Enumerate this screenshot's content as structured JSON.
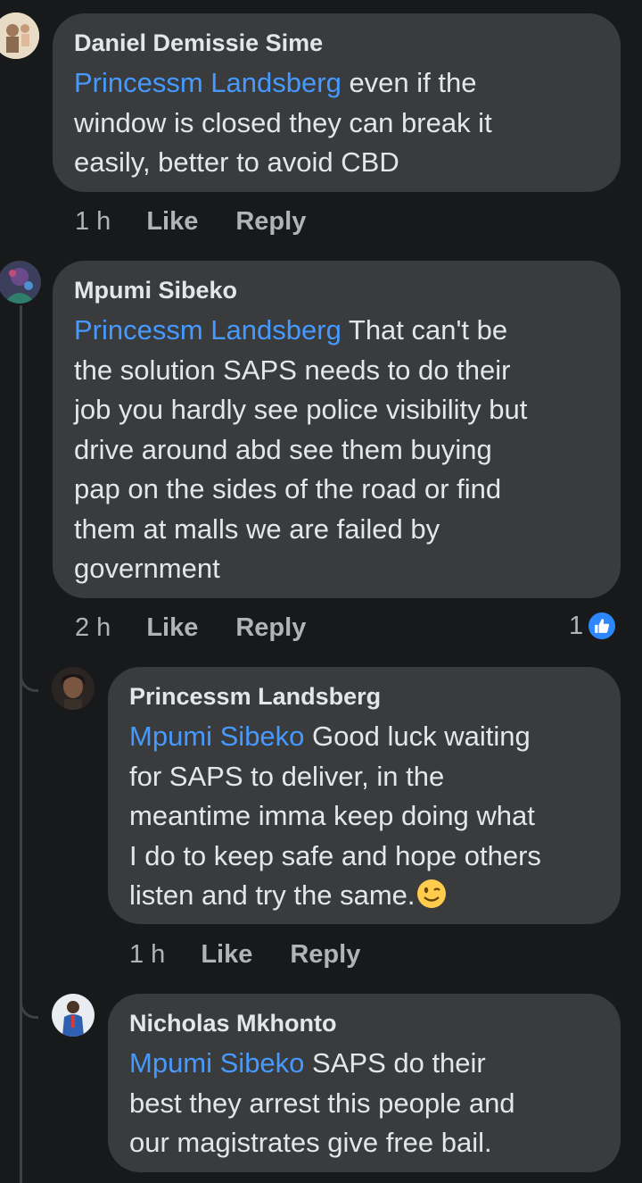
{
  "comments": [
    {
      "author": "Daniel Demissie Sime",
      "mention": "Princessm Landsberg",
      "text_lines": [
        " even if the",
        "window is closed they can break it",
        "easily, better to avoid CBD"
      ],
      "time": "1 h",
      "like": "Like",
      "reply": "Reply"
    },
    {
      "author": "Mpumi Sibeko",
      "mention": "Princessm Landsberg",
      "text_lines": [
        " That can't be",
        "the solution SAPS needs to do their",
        "job you hardly see police visibility but",
        "drive around abd see them buying",
        "pap on the sides of the road or find",
        "them at malls we are failed by",
        "government"
      ],
      "time": "2 h",
      "like": "Like",
      "reply": "Reply",
      "reaction_count": "1"
    },
    {
      "author": "Princessm Landsberg",
      "mention": "Mpumi Sibeko",
      "text_lines": [
        " Good luck waiting",
        "for SAPS to deliver, in the",
        "meantime imma keep doing what",
        "I do to keep safe and hope others",
        "listen and try the same."
      ],
      "emoji": "wink-emoji",
      "time": "1 h",
      "like": "Like",
      "reply": "Reply"
    },
    {
      "author": "Nicholas Mkhonto",
      "mention": "Mpumi Sibeko",
      "text_lines": [
        " SAPS do their",
        "best they arrest this people and",
        "our magistrates give free bail."
      ]
    }
  ]
}
